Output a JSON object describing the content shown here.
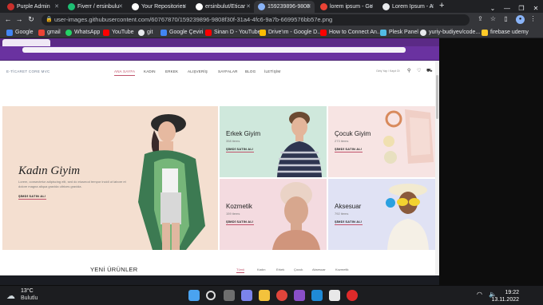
{
  "browser": {
    "tabs": [
      {
        "label": "Purple Admin",
        "icon": "purple-admin-favicon",
        "color": "#c9302c"
      },
      {
        "label": "Fiverr / ersinbulu",
        "icon": "fiverr-favicon",
        "color": "#1dbf73"
      },
      {
        "label": "Your Repositories",
        "icon": "github-favicon",
        "color": "#ffffff"
      },
      {
        "label": "ersinbulut/Eticar",
        "icon": "github-favicon",
        "color": "#ffffff"
      },
      {
        "label": "159239896-9808",
        "icon": "image-favicon",
        "color": "#8ab4f8"
      },
      {
        "label": "lorem ipsum - Go",
        "icon": "google-favicon",
        "color": "#ea4335"
      },
      {
        "label": "Lorem Ipsum - A",
        "icon": "lorem-favicon",
        "color": "#e8eaed"
      }
    ],
    "url": "user-images.githubusercontent.com/60767870/159239896-9808f30f-31a4-4fc6-9a7b-6699576bb57e.png",
    "bookmarks": [
      {
        "label": "Google",
        "color": "#4285f4"
      },
      {
        "label": "gmail",
        "color": "#ea4335"
      },
      {
        "label": "WhatsApp",
        "color": "#25d366"
      },
      {
        "label": "YouTube",
        "color": "#ff0000"
      },
      {
        "label": "git",
        "color": "#e8eaed"
      },
      {
        "label": "Google Çeviri",
        "color": "#4285f4"
      },
      {
        "label": "Sinan D - YouTube",
        "color": "#ff0000"
      },
      {
        "label": "Drive'ım - Google D...",
        "color": "#fbbc04"
      },
      {
        "label": "How to Connect An...",
        "color": "#ff0000"
      },
      {
        "label": "Plesk Panel",
        "color": "#52bbe6"
      },
      {
        "label": "yuriy-budiyev/code...",
        "color": "#e8eaed"
      },
      {
        "label": "firebase udemy",
        "color": "#ffca28"
      }
    ]
  },
  "site": {
    "logo": "E-TİCARET CORE MVC",
    "menu": [
      "ANA SAYFA",
      "KADIN",
      "ERKEK",
      "ALIŞVERİŞ",
      "SAYFALAR",
      "BLOG",
      "İLETİŞİM"
    ],
    "account_text": "Giriş Yap / Kayıt Ol",
    "hero": {
      "title": "Kadın Giyim",
      "desc": "Lorem, consectetur adipiscing elit, sed do eiusmod tempor incidi ut labore et dolore magna aliqua gravida ultrices gravida.",
      "cta": "ŞİMDİ SATIN AL!"
    },
    "tiles": [
      {
        "title": "Erkek Giyim",
        "count": "358 items",
        "cta": "ŞİMDİ SATIN AL!",
        "bg": "#cfe8dc"
      },
      {
        "title": "Çocuk Giyim",
        "count": "273 items",
        "cta": "ŞİMDİ SATIN AL!",
        "bg": "#f7e4e3"
      },
      {
        "title": "Kozmetik",
        "count": "159 items",
        "cta": "ŞİMDİ SATIN AL!",
        "bg": "#f4dbe0"
      },
      {
        "title": "Aksesuar",
        "count": "792 items",
        "cta": "ŞİMDİ SATIN AL!",
        "bg": "#e0e2f4"
      }
    ],
    "new_products": "YENİ ÜRÜNLER",
    "filter_tabs": [
      "Tümü",
      "Kadın",
      "Erkek",
      "Çocuk",
      "Aksesuar",
      "Kozmetik"
    ]
  },
  "taskbar": {
    "weather_temp": "13°C",
    "weather_desc": "Bulutlu",
    "time": "19:22",
    "date": "13.11.2022"
  }
}
